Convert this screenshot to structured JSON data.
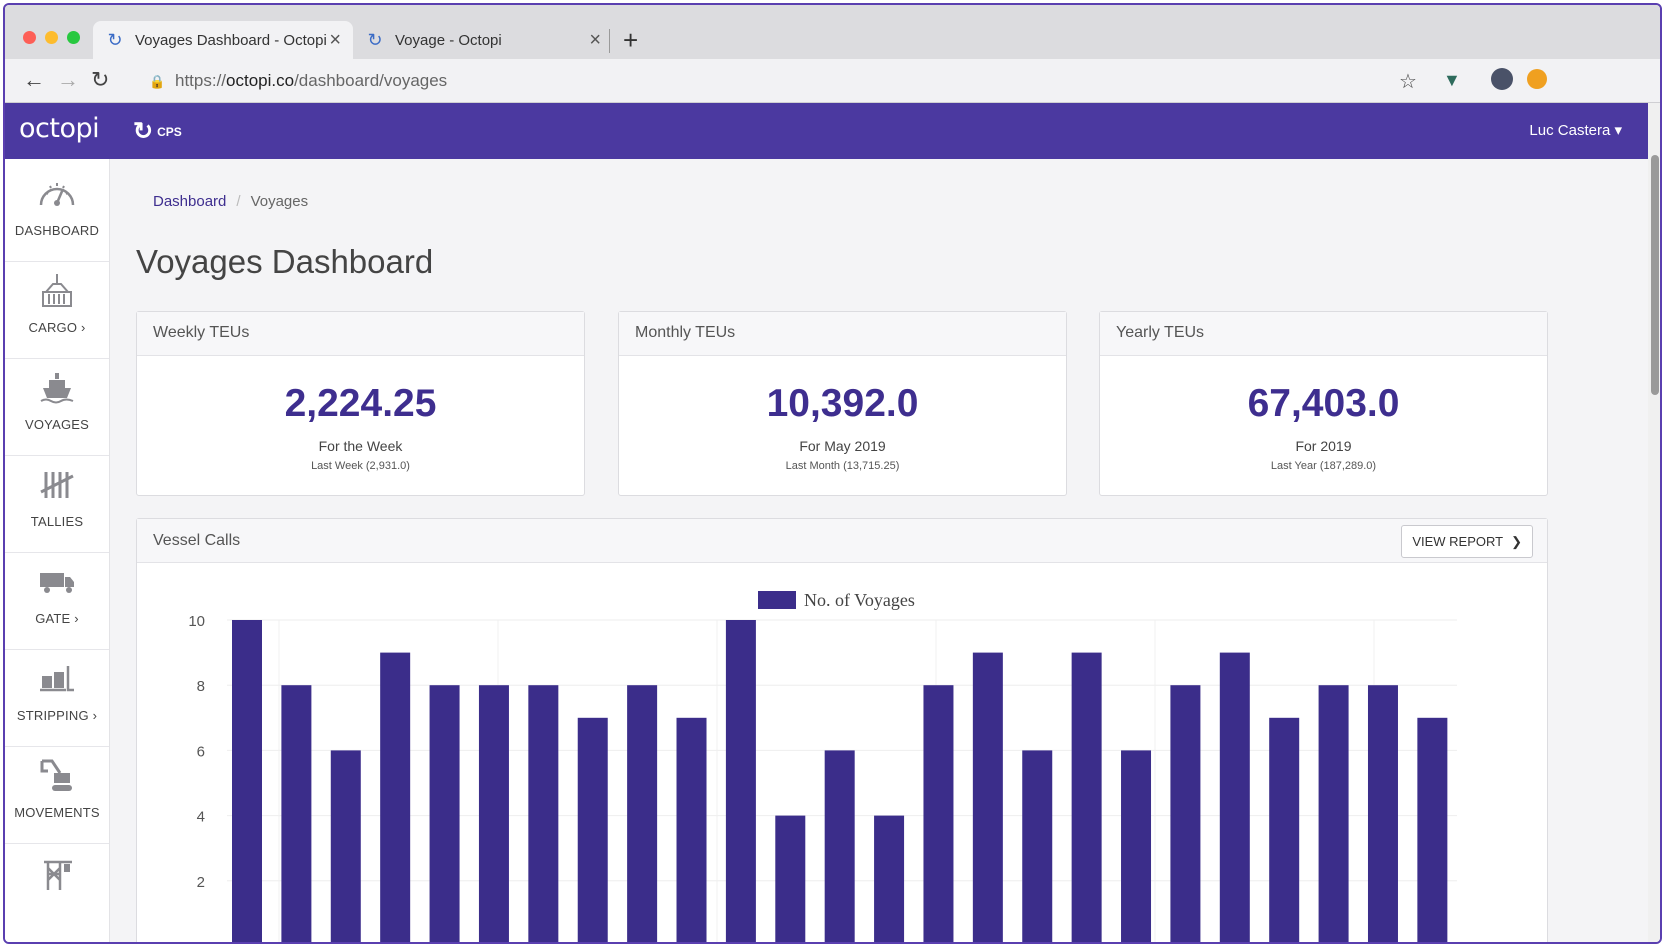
{
  "browser": {
    "tabs": [
      {
        "title": "Voyages Dashboard - Octopi",
        "active": true
      },
      {
        "title": "Voyage - Octopi",
        "active": false
      }
    ],
    "url_scheme": "https://",
    "url_host": "octopi.co",
    "url_path": "/dashboard/voyages"
  },
  "header": {
    "logo": "octopi",
    "partner_logo": "CPS",
    "user": "Luc Castera"
  },
  "sidebar": {
    "items": [
      {
        "label": "DASHBOARD",
        "icon": "gauge-icon"
      },
      {
        "label": "CARGO ›",
        "icon": "crane-container-icon"
      },
      {
        "label": "VOYAGES",
        "icon": "ship-icon"
      },
      {
        "label": "TALLIES",
        "icon": "tally-icon"
      },
      {
        "label": "GATE ›",
        "icon": "truck-icon"
      },
      {
        "label": "STRIPPING ›",
        "icon": "forklift-icon"
      },
      {
        "label": "MOVEMENTS",
        "icon": "excavator-icon"
      },
      {
        "label": "",
        "icon": "gantry-crane-icon"
      }
    ]
  },
  "breadcrumb": {
    "home": "Dashboard",
    "current": "Voyages"
  },
  "page": {
    "title": "Voyages Dashboard"
  },
  "cards": [
    {
      "title": "Weekly TEUs",
      "value": "2,224.25",
      "period": "For the Week",
      "previous": "Last Week (2,931.0)"
    },
    {
      "title": "Monthly TEUs",
      "value": "10,392.0",
      "period": "For May 2019",
      "previous": "Last Month (13,715.25)"
    },
    {
      "title": "Yearly TEUs",
      "value": "67,403.0",
      "period": "For 2019",
      "previous": "Last Year (187,289.0)"
    }
  ],
  "vessel_calls": {
    "title": "Vessel Calls",
    "view_report": "VIEW REPORT"
  },
  "chart_data": {
    "type": "bar",
    "series": [
      {
        "name": "No. of Voyages",
        "values": [
          10,
          8,
          6,
          9,
          8,
          8,
          8,
          7,
          8,
          7,
          10,
          4,
          6,
          4,
          8,
          9,
          6,
          9,
          6,
          8,
          9,
          7,
          8,
          8,
          7
        ]
      }
    ],
    "ylim": [
      0,
      10
    ],
    "yticks": [
      2,
      4,
      6,
      8,
      10
    ],
    "legend": "top-center",
    "grid": true,
    "color": "#3b2d8a"
  },
  "colors": {
    "brand": "#4b39a0",
    "accent": "#3e2e8f"
  }
}
